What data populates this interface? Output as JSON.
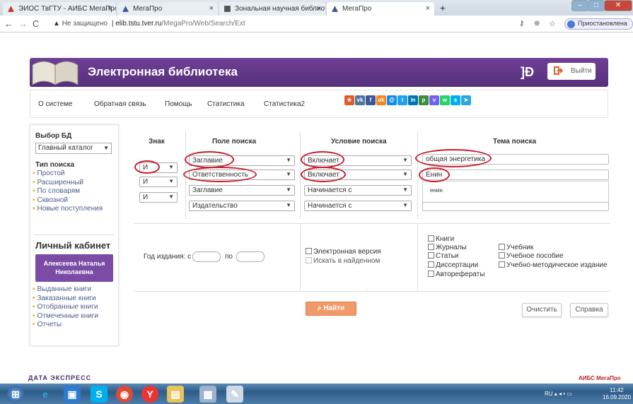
{
  "browser": {
    "tabs": [
      {
        "title": "ЭИОС ТвГТУ - АИБС МегаПро"
      },
      {
        "title": "МегаПро"
      },
      {
        "title": "Зональная научная библиотека"
      },
      {
        "title": "МегаПро"
      }
    ],
    "new_tab": "+",
    "security_label": "Не защищено",
    "url_host": "elib.tstu.tver.ru",
    "url_path": "/MegaPro/Web/Search/Ext",
    "profile_label": "Приостановлена"
  },
  "header": {
    "title": "Электронная библиотека",
    "logo_mark": "]Ð",
    "exit_label": "Выйти"
  },
  "menu": {
    "items": [
      "О системе",
      "Обратная связь",
      "Помощь",
      "Статистика",
      "Статистика2"
    ]
  },
  "social": {
    "icons": [
      {
        "name": "bookmark-icon",
        "glyph": "★",
        "color": "#e05a2a"
      },
      {
        "name": "vk-icon",
        "glyph": "vk",
        "color": "#4c75a3"
      },
      {
        "name": "facebook-icon",
        "glyph": "f",
        "color": "#3b5998"
      },
      {
        "name": "odnoklassniki-icon",
        "glyph": "ok",
        "color": "#f5871f"
      },
      {
        "name": "mail-icon",
        "glyph": "@",
        "color": "#168de2"
      },
      {
        "name": "twitter-icon",
        "glyph": "t",
        "color": "#1da1f2"
      },
      {
        "name": "linkedin-icon",
        "glyph": "in",
        "color": "#0077b5"
      },
      {
        "name": "pinterest-icon",
        "glyph": "p",
        "color": "#3d8d3d"
      },
      {
        "name": "viber-icon",
        "glyph": "v",
        "color": "#7360f2"
      },
      {
        "name": "whatsapp-icon",
        "glyph": "w",
        "color": "#25d366"
      },
      {
        "name": "skype-icon",
        "glyph": "s",
        "color": "#00aff0"
      },
      {
        "name": "telegram-icon",
        "glyph": "➤",
        "color": "#2ca5e0"
      }
    ]
  },
  "sidebar": {
    "db_heading": "Выбор БД",
    "db_selected": "Главный каталог",
    "search_type_heading": "Тип поиска",
    "search_types": [
      "Простой",
      "Расширенный",
      "По словарям",
      "Сквозной",
      "Новые поступления"
    ],
    "cabinet_heading": "Личный кабинет",
    "user_name": "Алексеева Наталья Николаевна",
    "cabinet_links": [
      "Выданные книги",
      "Заказанные книги",
      "Отобранные книги",
      "Отмеченные книги",
      "Отчеты"
    ]
  },
  "search": {
    "headers": {
      "sign": "Знак",
      "field": "Поле поиска",
      "condition": "Условие поиска",
      "term": "Тема поиска"
    },
    "rows": [
      {
        "sign": "",
        "field": "Заглавие",
        "condition": "Включает",
        "term": "общая энергетика"
      },
      {
        "sign": "И",
        "field": "Ответственность",
        "condition": "Включает",
        "term": "Енин"
      },
      {
        "sign": "И",
        "field": "Заглавие",
        "condition": "Начинается с",
        "term": ""
      },
      {
        "sign": "И",
        "field": "Издательство",
        "condition": "Начинается с",
        "term": ""
      }
    ],
    "suggestion": "енин",
    "year_label": "Год издания: с",
    "year_to_label": "по",
    "electronic_label": "Электронная версия",
    "search_in_found_label": "Искать в найденном",
    "doc_types_col1": [
      "Книги",
      "Журналы",
      "Статьи",
      "Диссертации",
      "Авторефераты"
    ],
    "doc_types_col2": [
      "Учебник",
      "Учебное пособие",
      "Учебно-методическое издание"
    ],
    "find_label": "Найти",
    "clear_label": "Очистить",
    "help_label": "Справка"
  },
  "footer": {
    "left_logo": "ДАТА ЭКСПРЕСС",
    "right_logo": "АИБС МегаПро"
  },
  "taskbar": {
    "lang": "RU",
    "time": "11:42",
    "date": "16.09.2020"
  }
}
